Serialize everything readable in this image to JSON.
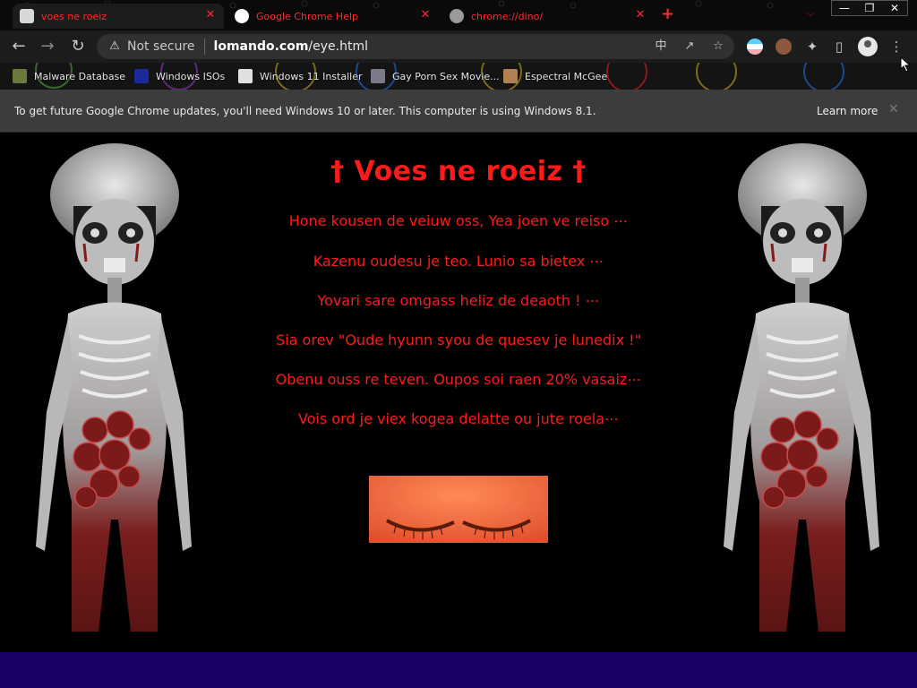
{
  "tabs": [
    {
      "title": "voes ne roeiz",
      "active": true
    },
    {
      "title": "Google Chrome Help",
      "active": false
    },
    {
      "title": "chrome://dino/",
      "active": false
    }
  ],
  "tab_close_glyph": "✕",
  "new_tab_glyph": "+",
  "window_controls": {
    "minimize": "—",
    "maximize": "❐",
    "close": "✕"
  },
  "toolbar": {
    "back": "←",
    "forward": "→",
    "reload": "↻",
    "security_label": "Not secure",
    "url_domain": "lomando.com",
    "url_path": "/eye.html"
  },
  "bookmarks": [
    "Malware Database",
    "Windows ISOs",
    "Windows 11 Installer",
    "Gay Porn Sex Movie...",
    "Espectral McGee"
  ],
  "infobar": {
    "message": "To get future Google Chrome updates, you'll need Windows 10 or later. This computer is using Windows 8.1.",
    "learn_more": "Learn more",
    "close": "✕"
  },
  "page": {
    "title": "† Voes ne roeiz †",
    "lines": [
      "Hone kousen de veiuw oss, Yea joen ve reiso ⋯",
      "Kazenu oudesu je teo. Lunio sa bietex ⋯",
      "Yovari sare omgass heliz de deaoth ! ⋯",
      "Sia orev \"Oude hyunn syou de quesev je lunedix !\"",
      "Obenu ouss re teven. Oupos soi raen 20% vasaiz⋯",
      "Vois ord je viex kogea delatte ou jute roela⋯"
    ]
  },
  "colors": {
    "page_text": "#ff1a1a",
    "tab_text": "#ff2a2a",
    "footer_bar": "#1a0066",
    "infobar_bg": "#3c3c3c"
  }
}
